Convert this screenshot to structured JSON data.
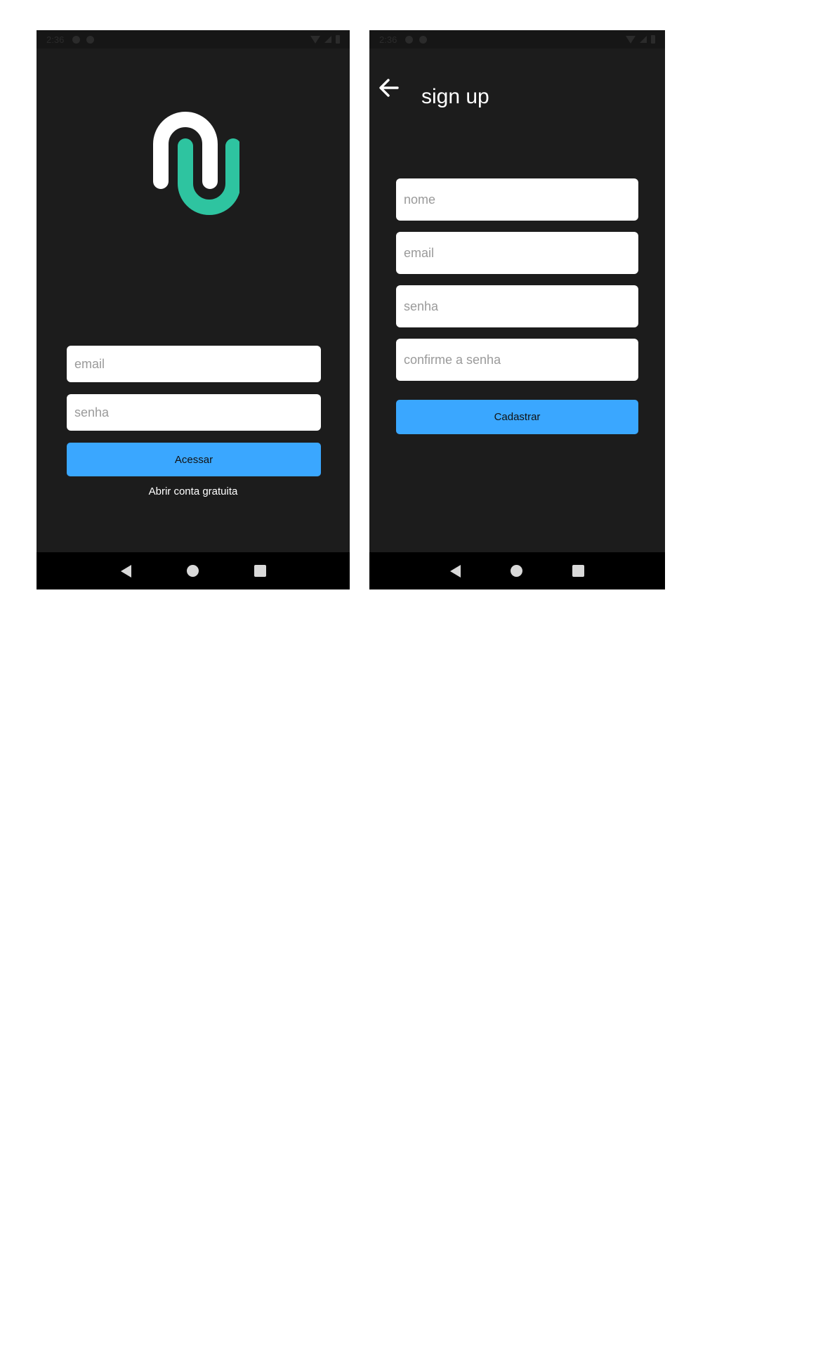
{
  "login": {
    "status_time": "2:36",
    "email_placeholder": "email",
    "password_placeholder": "senha",
    "submit_label": "Acessar",
    "signup_link": "Abrir conta gratuita"
  },
  "signup": {
    "status_time": "2:36",
    "title": "sign up",
    "name_placeholder": "nome",
    "email_placeholder": "email",
    "password_placeholder": "senha",
    "confirm_placeholder": "confirme a senha",
    "submit_label": "Cadastrar"
  },
  "icons": {
    "logo": "nu-logo",
    "back": "arrow-left-icon",
    "nav": [
      "nav-back-icon",
      "nav-home-icon",
      "nav-recent-icon"
    ]
  },
  "colors": {
    "background": "#1c1c1c",
    "primary_button": "#3aa7ff",
    "logo_white": "#ffffff",
    "logo_teal": "#2ec4a0",
    "nav_bar": "#000000"
  }
}
